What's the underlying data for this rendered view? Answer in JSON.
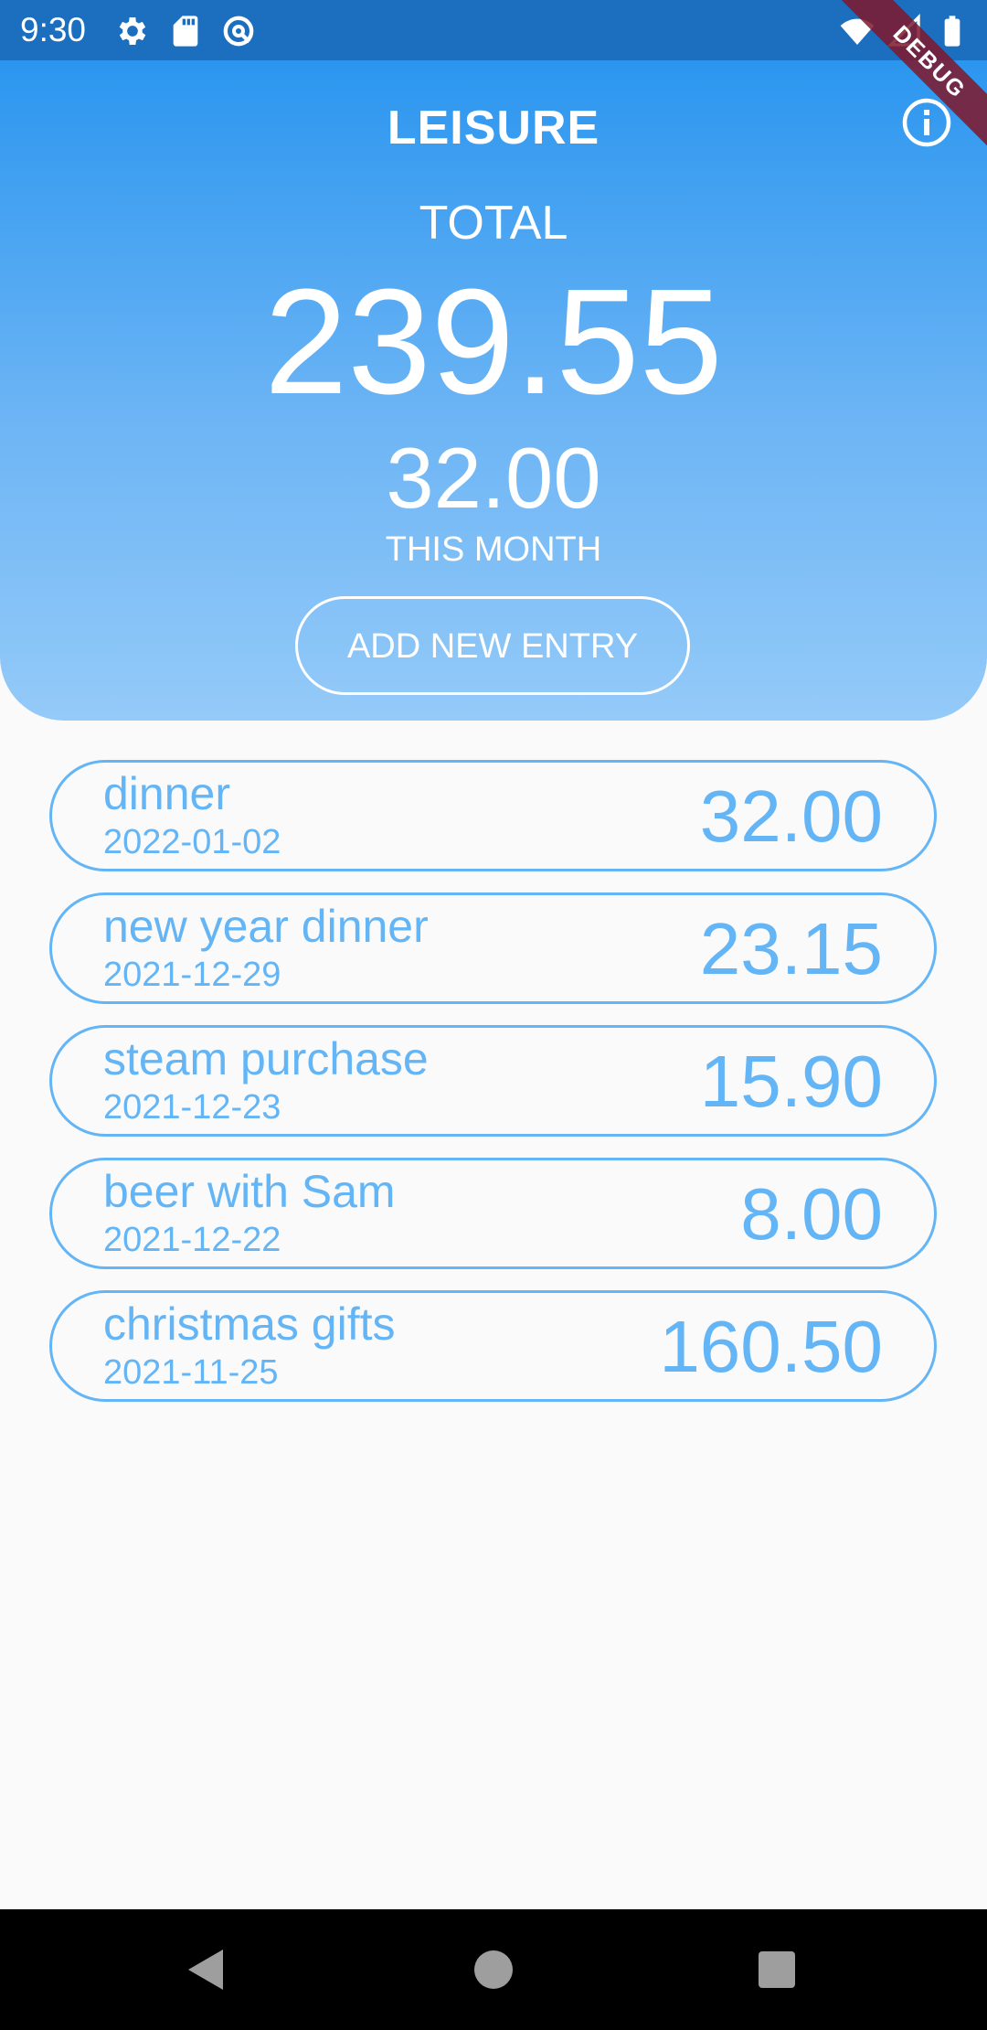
{
  "status_bar": {
    "time": "9:30",
    "left_icons": [
      "gear-icon",
      "sd-card-icon",
      "data-saver-icon"
    ],
    "right_icons": [
      "wifi-icon",
      "cellular-signal-icon",
      "battery-icon"
    ]
  },
  "debug_banner": {
    "label": "DEBUG"
  },
  "header": {
    "title": "LEISURE",
    "info_icon": "info-icon",
    "total_label": "TOTAL",
    "total_value": "239.55",
    "month_value": "32.00",
    "month_label": "THIS MONTH",
    "add_button_label": "ADD NEW ENTRY"
  },
  "entries": [
    {
      "name": "dinner",
      "date": "2022-01-02",
      "amount": "32.00"
    },
    {
      "name": "new year dinner",
      "date": "2021-12-29",
      "amount": "23.15"
    },
    {
      "name": "steam purchase",
      "date": "2021-12-23",
      "amount": "15.90"
    },
    {
      "name": "beer with Sam",
      "date": "2021-12-22",
      "amount": "8.00"
    },
    {
      "name": "christmas gifts",
      "date": "2021-11-25",
      "amount": "160.50"
    }
  ],
  "nav_bar": {
    "icons": [
      "back-icon",
      "home-icon",
      "recents-icon"
    ]
  },
  "colors": {
    "status_bar": "#1c6fbf",
    "header_top": "#2b96ef",
    "header_bottom": "#94caf8",
    "entry_accent": "#64b5f6",
    "background": "#fafafa",
    "debug_banner": "#80182a"
  }
}
